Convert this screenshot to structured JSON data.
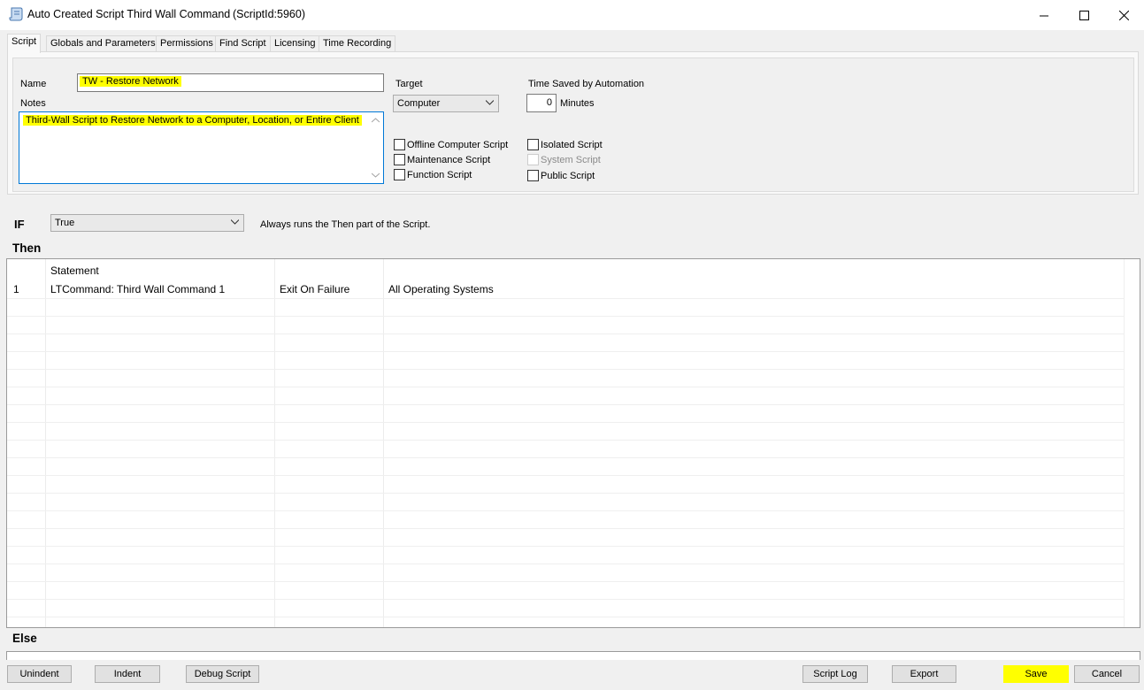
{
  "window": {
    "title": "Auto Created Script Third Wall Command",
    "script_id": "(ScriptId:5960)"
  },
  "tabs": [
    {
      "label": "Script",
      "active": true
    },
    {
      "label": "Globals and Parameters"
    },
    {
      "label": "Permissions"
    },
    {
      "label": "Find Script"
    },
    {
      "label": "Licensing"
    },
    {
      "label": "Time Recording"
    }
  ],
  "form": {
    "name_label": "Name",
    "name_value": "TW - Restore Network",
    "notes_label": "Notes",
    "notes_value": "Third-Wall Script to Restore Network to a Computer, Location, or Entire Client",
    "target_label": "Target",
    "target_value": "Computer",
    "time_saved_label": "Time Saved by Automation",
    "time_saved_value": "0",
    "minutes_label": "Minutes",
    "checkboxes": [
      {
        "label": "Offline Computer Script",
        "checked": false
      },
      {
        "label": "Maintenance Script",
        "checked": false
      },
      {
        "label": "Function Script",
        "checked": false
      },
      {
        "label": "Isolated Script",
        "checked": false
      },
      {
        "label": "System Script",
        "checked": false,
        "disabled": true
      },
      {
        "label": "Public Script",
        "checked": false
      }
    ]
  },
  "if_section": {
    "label": "IF",
    "condition": "True",
    "description": "Always runs the Then part of the Script."
  },
  "then_section": {
    "label": "Then",
    "columns": [
      "",
      "Statement",
      "",
      ""
    ],
    "rows": [
      {
        "num": "1",
        "statement": "LTCommand: Third Wall Command 1",
        "on_failure": "Exit On Failure",
        "os": "All Operating Systems"
      }
    ]
  },
  "else_section": {
    "label": "Else"
  },
  "buttons": {
    "unindent": "Unindent",
    "indent": "Indent",
    "debug": "Debug Script",
    "script_log": "Script Log",
    "export": "Export",
    "save": "Save",
    "cancel": "Cancel"
  },
  "colors": {
    "highlight": "#ffff00",
    "focus_border": "#0078d7"
  }
}
